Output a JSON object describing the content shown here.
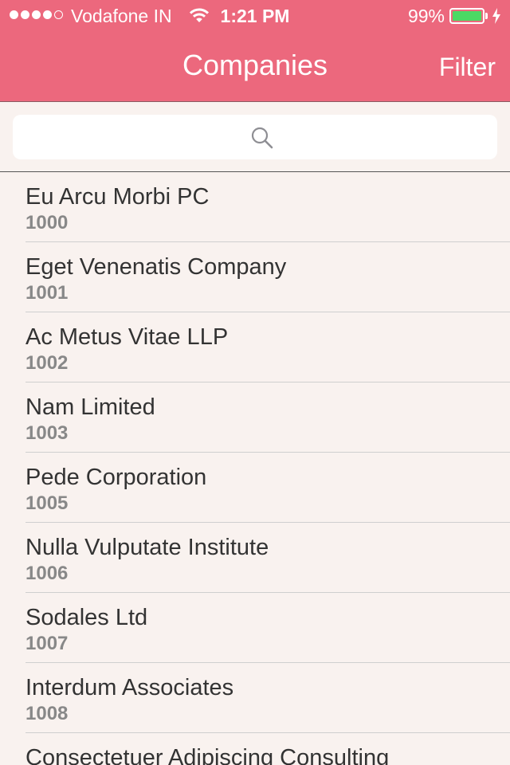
{
  "status_bar": {
    "carrier": "Vodafone IN",
    "time": "1:21 PM",
    "battery_percent": "99%",
    "battery_level": 0.99,
    "signal_bars_filled": 4,
    "signal_bars_total": 5
  },
  "nav": {
    "title": "Companies",
    "filter_label": "Filter"
  },
  "search": {
    "placeholder": "",
    "icon": "search-icon"
  },
  "companies": [
    {
      "name": "Eu Arcu Morbi PC",
      "id": "1000"
    },
    {
      "name": "Eget Venenatis Company",
      "id": "1001"
    },
    {
      "name": "Ac Metus Vitae LLP",
      "id": "1002"
    },
    {
      "name": "Nam Limited",
      "id": "1003"
    },
    {
      "name": "Pede Corporation",
      "id": "1005"
    },
    {
      "name": "Nulla Vulputate Institute",
      "id": "1006"
    },
    {
      "name": "Sodales Ltd",
      "id": "1007"
    },
    {
      "name": "Interdum Associates",
      "id": "1008"
    },
    {
      "name": "Consectetuer Adipiscing Consulting",
      "id": ""
    }
  ],
  "colors": {
    "nav_background": "#ec687d",
    "list_background": "#f9f2ef",
    "battery_fill": "#4cd964"
  }
}
